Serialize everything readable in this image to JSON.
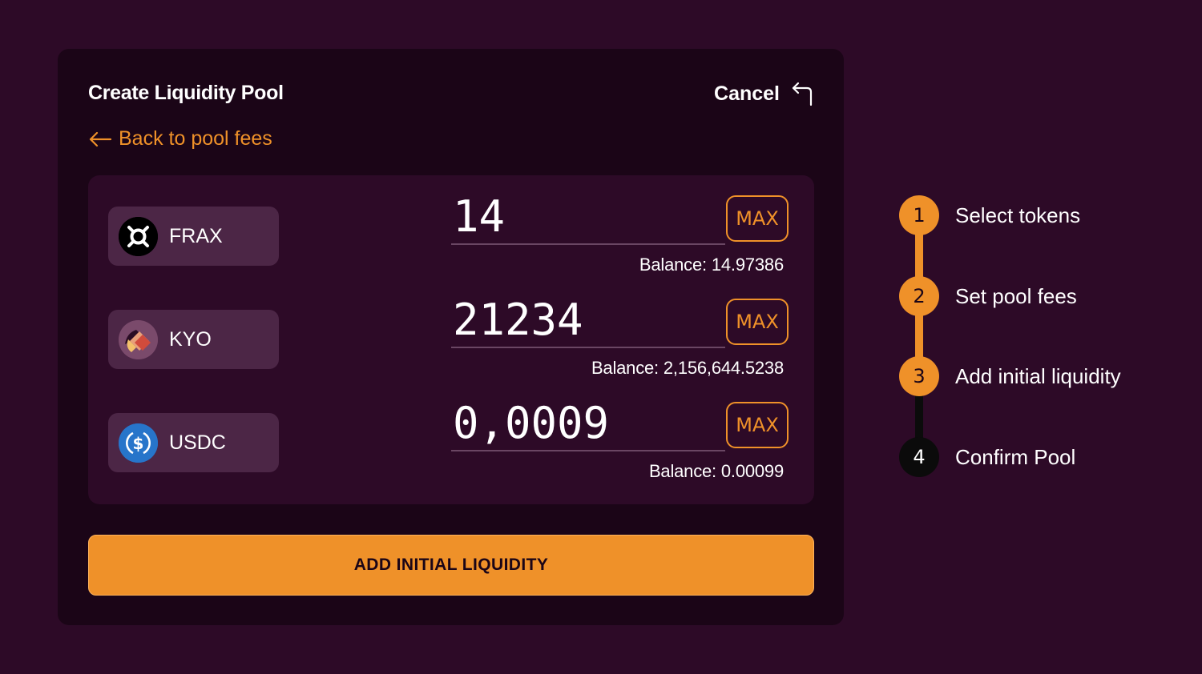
{
  "header": {
    "title": "Create Liquidity Pool",
    "cancel_label": "Cancel",
    "back_label": "Back to pool fees"
  },
  "tokens": [
    {
      "symbol": "FRAX",
      "amount": "14",
      "balance": "Balance: 14.97386",
      "max_label": "MAX",
      "icon": "frax-logo-icon"
    },
    {
      "symbol": "KYO",
      "amount": "21234",
      "balance": "Balance: 2,156,644.5238",
      "max_label": "MAX",
      "icon": "kyo-logo-icon"
    },
    {
      "symbol": "USDC",
      "amount": "0,0009",
      "balance": "Balance: 0.00099",
      "max_label": "MAX",
      "icon": "usdc-logo-icon"
    }
  ],
  "action": {
    "submit_label": "ADD INITIAL LIQUIDITY"
  },
  "steps": [
    {
      "number": "1",
      "label": "Select tokens",
      "state": "complete"
    },
    {
      "number": "2",
      "label": "Set pool fees",
      "state": "complete"
    },
    {
      "number": "3",
      "label": "Add initial liquidity",
      "state": "current"
    },
    {
      "number": "4",
      "label": "Confirm Pool",
      "state": "pending"
    }
  ],
  "colors": {
    "background": "#2d0a27",
    "card": "#1b0517",
    "accent": "#ef9129",
    "chip": "#4c2646",
    "pending": "#0b0b0b"
  }
}
